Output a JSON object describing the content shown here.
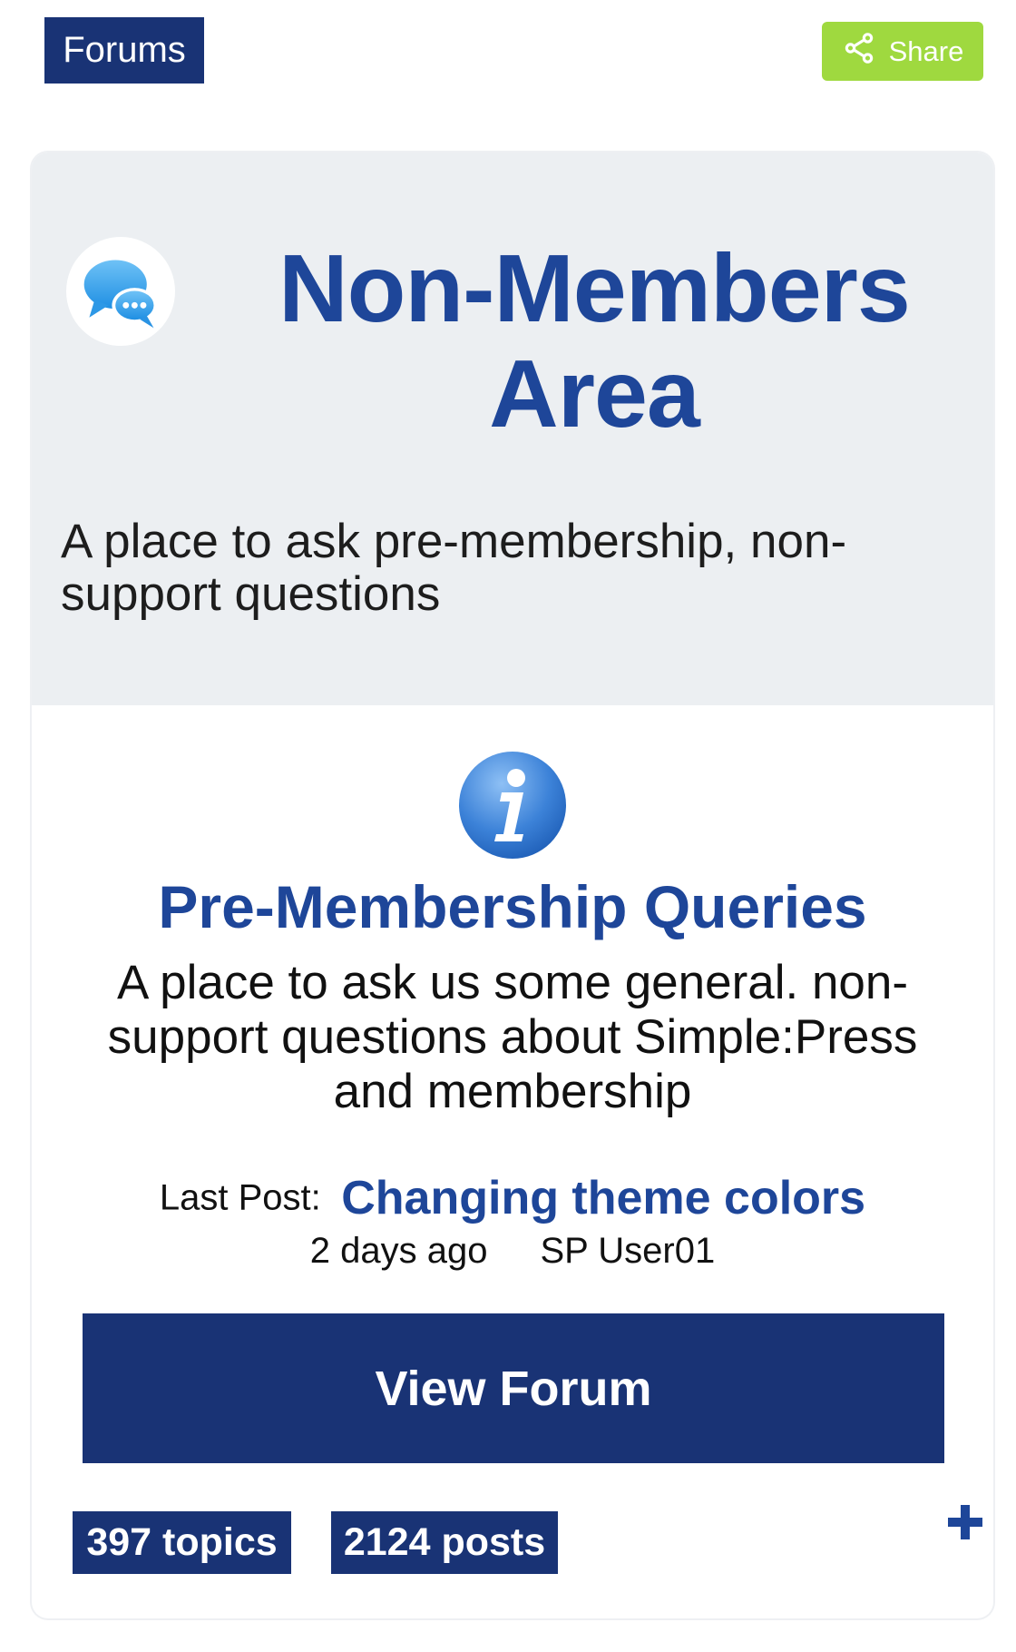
{
  "header": {
    "forums_label": "Forums",
    "share_label": "Share"
  },
  "group": {
    "title": "Non-Members Area",
    "description": "A place to ask pre-membership, non-support questions"
  },
  "forum": {
    "title": "Pre-Membership Queries",
    "description": "A place to ask us some general. non-support questions about Simple:Press and membership",
    "last_post_label": "Last Post:",
    "last_post_title": "Changing theme colors",
    "last_post_time": "2 days ago",
    "last_post_user": "SP User01",
    "view_button_label": "View Forum",
    "topics": "397 topics",
    "posts": "2124 posts",
    "expand_label": "+"
  },
  "colors": {
    "navy": "#193375",
    "title_blue": "#1e4699",
    "share_green": "#9fd93f",
    "panel_gray": "#eceff2"
  },
  "icons": {
    "share": "share-icon",
    "group": "chat-bubbles-icon",
    "forum": "info-icon",
    "expand": "plus-icon"
  }
}
